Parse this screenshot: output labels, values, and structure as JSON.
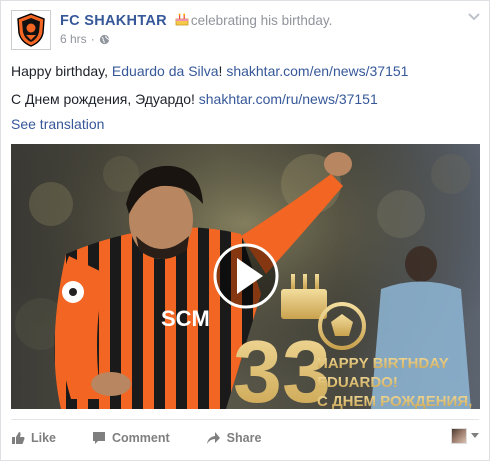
{
  "post": {
    "page_name": "FC SHAKHTAR",
    "activity": "celebrating his birthday.",
    "time": "6 hrs",
    "separator": "·",
    "line1": {
      "prefix": "Happy birthday, ",
      "person": "Eduardo da Silva",
      "exclaim": "! ",
      "url": "shakhtar.com/en/news/37151"
    },
    "line2": {
      "text": "С Днем рождения, Эдуардо! ",
      "url": "shakhtar.com/ru/news/37151"
    },
    "see_translation": "See translation"
  },
  "media": {
    "sponsor_text": "SCM",
    "age": "33",
    "line1": "HAPPY BIRTHDAY",
    "line2": "EDUARDO!",
    "line3": "С ДНЕМ РОЖДЕНИЯ,"
  },
  "actions": {
    "like": "Like",
    "comment": "Comment",
    "share": "Share"
  },
  "icons": {
    "logo": "shakhtar-crest-icon",
    "cake": "birthday-cake-icon",
    "globe": "globe-icon",
    "play": "play-icon"
  },
  "colors": {
    "link": "#365899",
    "muted": "#90949c",
    "shakhtar_orange": "#f26522",
    "gold": "#e2c27a"
  }
}
